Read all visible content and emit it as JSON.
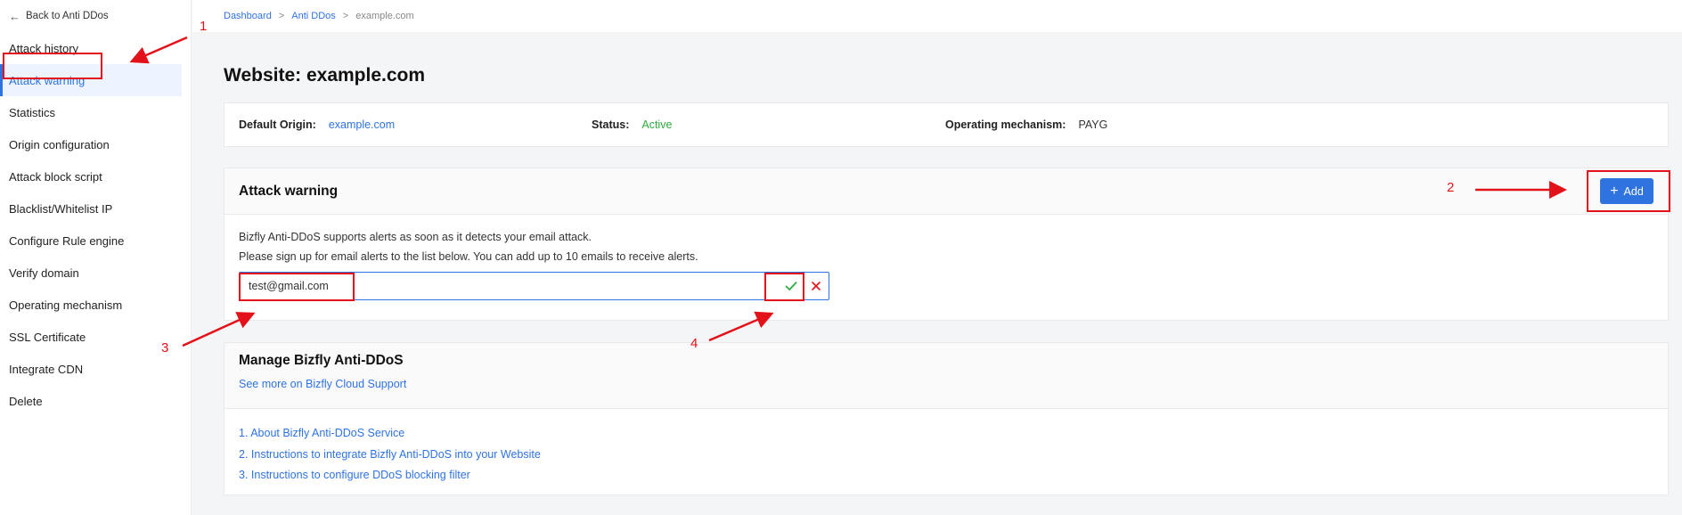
{
  "sidebar": {
    "back_label": "Back to Anti DDos",
    "items": [
      {
        "label": "Attack history"
      },
      {
        "label": "Attack warning"
      },
      {
        "label": "Statistics"
      },
      {
        "label": "Origin configuration"
      },
      {
        "label": "Attack block script"
      },
      {
        "label": "Blacklist/Whitelist IP"
      },
      {
        "label": "Configure Rule engine"
      },
      {
        "label": "Verify domain"
      },
      {
        "label": "Operating mechanism"
      },
      {
        "label": "SSL Certificate"
      },
      {
        "label": "Integrate CDN"
      },
      {
        "label": "Delete"
      }
    ],
    "active_index": 1
  },
  "breadcrumb": {
    "items": [
      "Dashboard",
      "Anti DDos",
      "example.com"
    ],
    "separator": ">"
  },
  "page": {
    "title": "Website: example.com"
  },
  "info": {
    "origin_label": "Default Origin:",
    "origin_value": "example.com",
    "status_label": "Status:",
    "status_value": "Active",
    "mechanism_label": "Operating mechanism:",
    "mechanism_value": "PAYG"
  },
  "attack_warning": {
    "title": "Attack warning",
    "add_label": "Add",
    "desc_line1": "Bizfly Anti-DDoS supports alerts as soon as it detects your email attack.",
    "desc_line2": "Please sign up for email alerts to the list below. You can add up to 10 emails to receive alerts.",
    "email_value": "test@gmail.com"
  },
  "manage": {
    "title": "Manage Bizfly Anti-DDoS",
    "support_link": "See more on Bizfly Cloud Support",
    "links": [
      "1. About Bizfly Anti-DDoS Service",
      "2. Instructions to integrate Bizfly Anti-DDoS into your Website",
      "3. Instructions to configure DDoS blocking filter"
    ]
  },
  "annotations": {
    "labels": [
      "1",
      "2",
      "3",
      "4"
    ]
  },
  "colors": {
    "accent": "#2f73e0",
    "success": "#2eaa3e",
    "annotation": "#e3121a"
  }
}
